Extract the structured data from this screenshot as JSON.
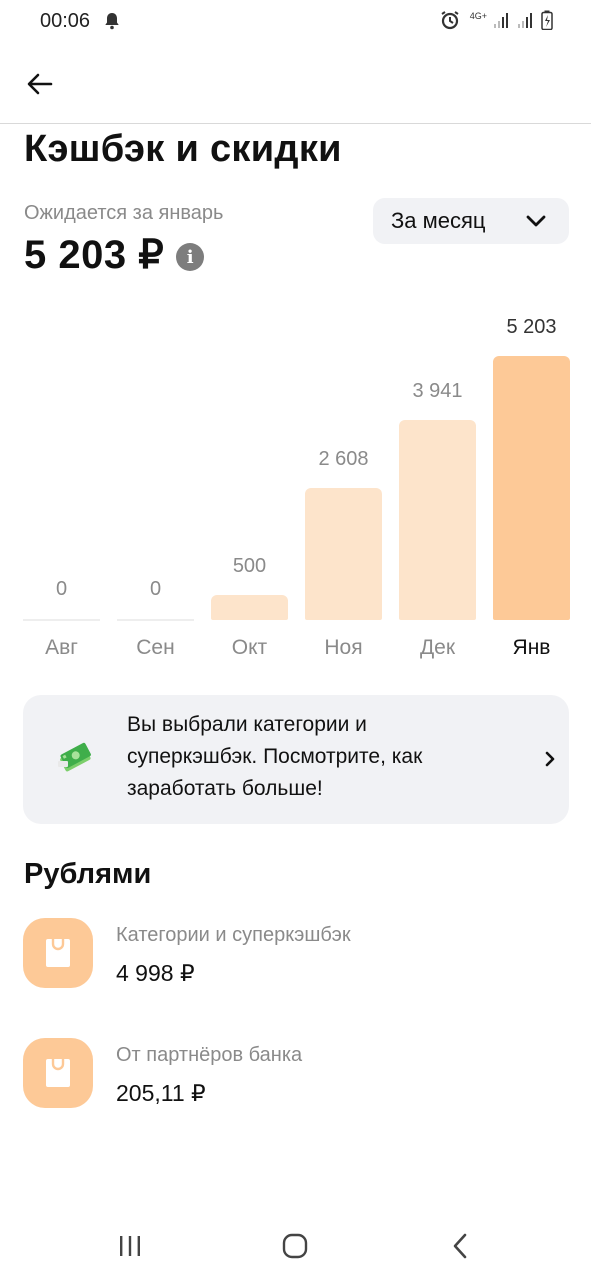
{
  "status_bar": {
    "time": "00:06",
    "network": "4G+"
  },
  "header": {
    "title": "Кэшбэк и скидки"
  },
  "summary": {
    "label": "Ожидается за январь",
    "amount": "5 203 ₽",
    "period": "За месяц"
  },
  "chart_data": {
    "type": "bar",
    "categories": [
      "Авг",
      "Сен",
      "Окт",
      "Ноя",
      "Дек",
      "Янв"
    ],
    "values": [
      0,
      0,
      500,
      2608,
      3941,
      5203
    ],
    "value_labels": [
      "0",
      "0",
      "500",
      "2 608",
      "3 941",
      "5 203"
    ],
    "highlight_index": 5,
    "colors": {
      "bar": "#fde4cb",
      "highlight": "#fdc997",
      "baseline": "#eeeeee"
    }
  },
  "promo": {
    "text": "Вы выбрали категории и суперкэшбэк. Посмотрите, как заработать больше!"
  },
  "rubles": {
    "title": "Рублями",
    "items": [
      {
        "title": "Категории и суперкэшбэк",
        "amount": "4 998 ₽"
      },
      {
        "title": "От партнёров банка",
        "amount": "205,11 ₽"
      }
    ]
  },
  "colors": {
    "accent": "#fdc997",
    "card_bg": "#f1f2f5",
    "muted_text": "#8a8a8a"
  }
}
